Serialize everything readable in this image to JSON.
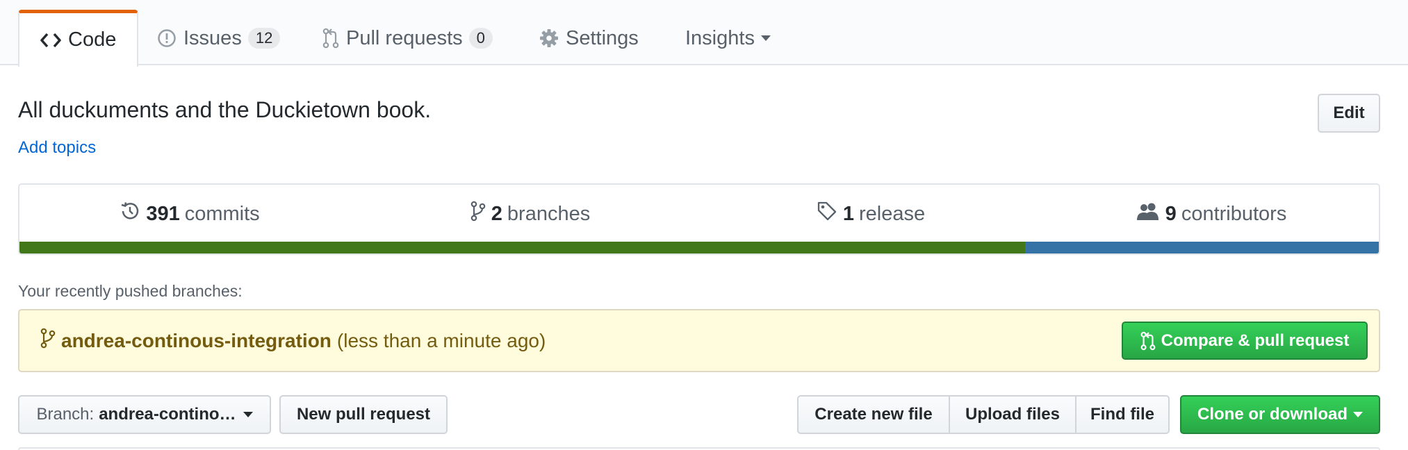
{
  "tabs": [
    {
      "label": "Code",
      "icon": "code-icon",
      "selected": true
    },
    {
      "label": "Issues",
      "icon": "issue-icon",
      "count": "12"
    },
    {
      "label": "Pull requests",
      "icon": "pull-request-icon",
      "count": "0"
    },
    {
      "label": "Settings",
      "icon": "gear-icon"
    },
    {
      "label": "Insights",
      "icon": "chevron-down-icon"
    }
  ],
  "repo": {
    "description": "All duckuments and the Duckietown book.",
    "add_topics": "Add topics",
    "edit_label": "Edit"
  },
  "summary": {
    "commits": {
      "count": "391",
      "label": "commits",
      "icon": "history-icon"
    },
    "branches": {
      "count": "2",
      "label": "branches",
      "icon": "branch-icon"
    },
    "releases": {
      "count": "1",
      "label": "release",
      "icon": "tag-icon"
    },
    "contributors": {
      "count": "9",
      "label": "contributors",
      "icon": "people-icon"
    },
    "languages": [
      {
        "color": "#427819",
        "fraction": 0.74
      },
      {
        "color": "#3572A5",
        "fraction": 0.26
      }
    ]
  },
  "recent": {
    "label": "Your recently pushed branches:",
    "branch": "andrea-continous-integration",
    "time": "(less than a minute ago)",
    "compare_label": "Compare & pull request"
  },
  "filenav": {
    "branch_label": "Branch:",
    "branch_value": "andrea-contino…",
    "new_pr": "New pull request",
    "create_file": "Create new file",
    "upload_files": "Upload files",
    "find_file": "Find file",
    "clone": "Clone or download"
  },
  "colors": {
    "accent": "#e36209",
    "link": "#0366d6",
    "green": "#28a745"
  }
}
